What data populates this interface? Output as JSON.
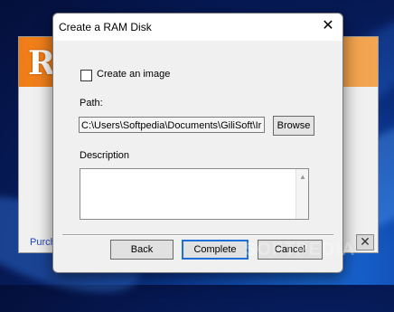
{
  "background_app": {
    "logo_text": "R",
    "purchase_link": "Purch",
    "close_glyph": "✕",
    "accent_color": "#f07c17"
  },
  "dialog": {
    "title": "Create a RAM Disk",
    "close_glyph": "✕",
    "create_image": {
      "label": "Create an image",
      "checked": false
    },
    "path": {
      "label": "Path:",
      "value": "C:\\Users\\Softpedia\\Documents\\GiliSoft\\Ir"
    },
    "browse_button": "Browse",
    "description": {
      "label": "Description",
      "value": ""
    },
    "buttons": {
      "back": "Back",
      "complete": "Complete",
      "cancel": "Cancel"
    }
  },
  "watermark": "SOFTPEDIA"
}
